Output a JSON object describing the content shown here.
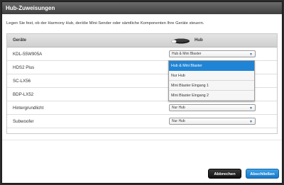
{
  "dialog": {
    "title": "Hub-Zuweisungen",
    "instruction": "Legen Sie fest, ob der Harmony Hub, der/die Mini-Sender oder sämtliche Komponenten Ihre Geräte steuern."
  },
  "table": {
    "col_devices": "Geräte",
    "col_hub": "Hub",
    "rows": [
      {
        "device": "KDL-55W905A",
        "value": "Hub & Mini Blaster"
      },
      {
        "device": "HDS2 Plus",
        "value": ""
      },
      {
        "device": "SC-LX56",
        "value": ""
      },
      {
        "device": "BDP-LX52",
        "value": ""
      },
      {
        "device": "Hintergrundlicht",
        "value": "Nur Hub"
      },
      {
        "device": "Subwoofer",
        "value": "Nur Hub"
      }
    ]
  },
  "dropdown": {
    "options": [
      "Hub & Mini Blaster",
      "Nur Hub",
      "Mini Blaster Eingang 1",
      "Mini Blaster Eingang 2"
    ],
    "selected": "Hub & Mini Blaster"
  },
  "buttons": {
    "cancel": "Abbrechen",
    "finish": "Abschließen"
  },
  "colors": {
    "accent": "#1f84d6",
    "titlebar": "#4a4a4a"
  }
}
